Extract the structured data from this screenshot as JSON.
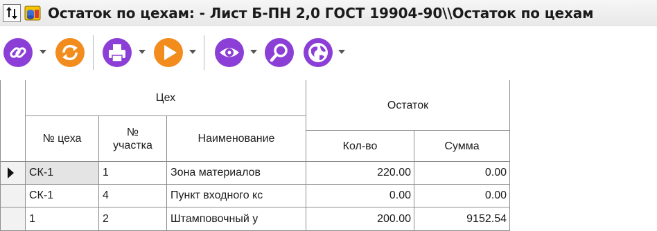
{
  "window": {
    "title": "Остаток по цехам:  - Лист Б-ПН 2,0 ГОСТ 19904-90\\\\Остаток по цехам"
  },
  "toolbar": {
    "buttons": [
      {
        "name": "link-button",
        "icon": "link-icon",
        "color": "#8b3fd6",
        "dropdown": true
      },
      {
        "name": "refresh-button",
        "icon": "refresh-icon",
        "color": "#f28c1c",
        "dropdown": false
      },
      {
        "name": "print-button",
        "icon": "printer-icon",
        "color": "#8b3fd6",
        "dropdown": true
      },
      {
        "name": "run-button",
        "icon": "play-icon",
        "color": "#f28c1c",
        "dropdown": true
      },
      {
        "name": "view-button",
        "icon": "eye-icon",
        "color": "#8b3fd6",
        "dropdown": true
      },
      {
        "name": "search-button",
        "icon": "magnifier-icon",
        "color": "#8b3fd6",
        "dropdown": false
      },
      {
        "name": "map-button",
        "icon": "globe-icon",
        "color": "#8b3fd6",
        "dropdown": true
      }
    ]
  },
  "grid": {
    "group_workshop": "Цех",
    "group_remainder": "Остаток",
    "columns": {
      "shop_no": "№ цеха",
      "section_no": "№\nучастка",
      "name": "Наименование",
      "qty": "Кол-во",
      "sum": "Сумма"
    },
    "rows": [
      {
        "shop_no": "СК-1",
        "section_no": "1",
        "name": "Зона материалов",
        "qty": "220.00",
        "sum": "0.00",
        "selected": true
      },
      {
        "shop_no": "СК-1",
        "section_no": "4",
        "name": "Пункт входного кс",
        "qty": "0.00",
        "sum": "0.00",
        "selected": false
      },
      {
        "shop_no": "1",
        "section_no": "2",
        "name": "Штамповочный у",
        "qty": "200.00",
        "sum": "9152.54",
        "selected": false
      }
    ]
  },
  "colors": {
    "accent_purple": "#8b3fd6",
    "accent_orange": "#f28c1c",
    "grid_line": "#8c8c8c",
    "selected_cell": "#e4e4e4"
  }
}
